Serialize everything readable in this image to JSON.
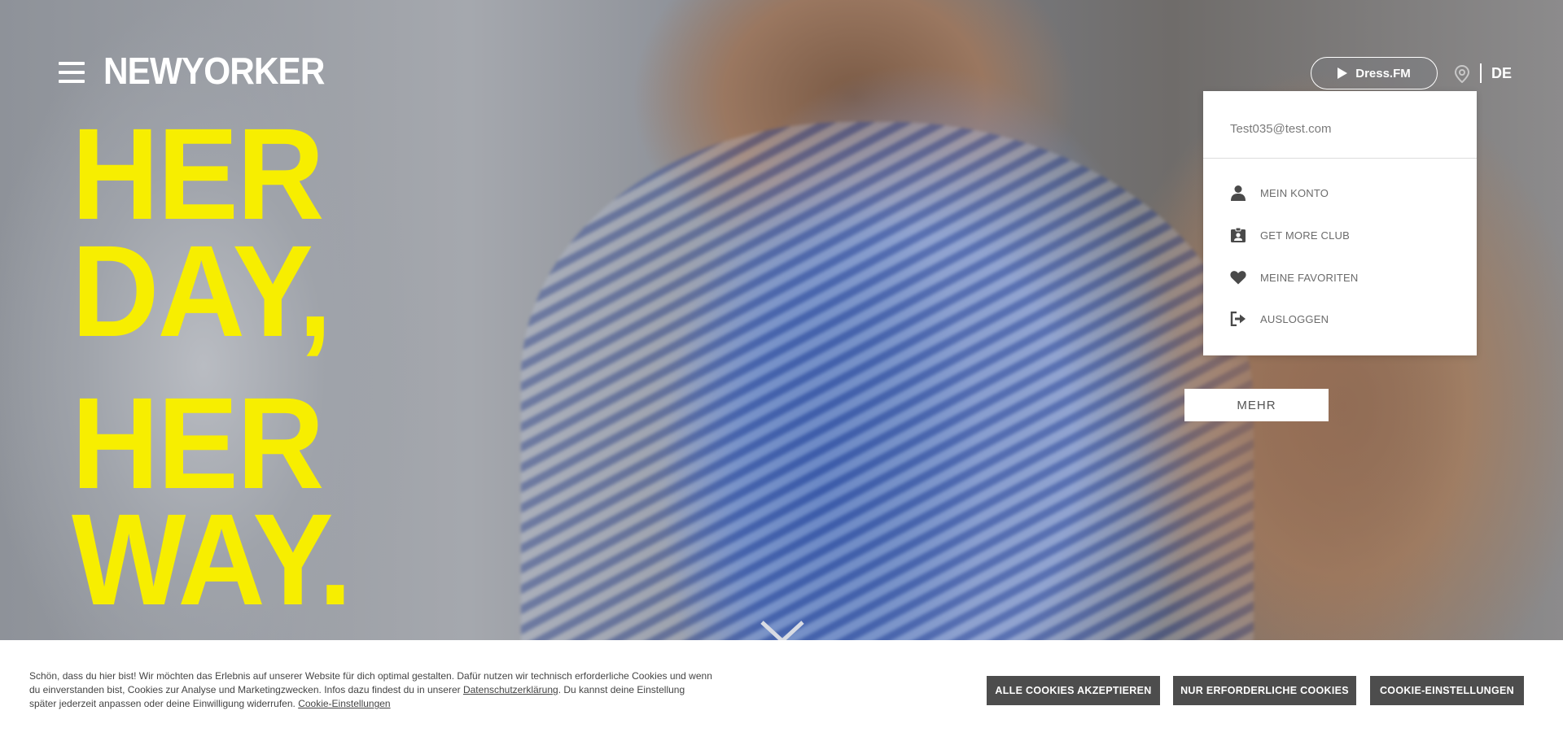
{
  "header": {
    "logo_text": "NEWYORKER",
    "dressfm_label": "Dress.FM",
    "language": "DE"
  },
  "account_menu": {
    "email": "Test035@test.com",
    "items": [
      {
        "label": "MEIN KONTO",
        "icon": "user-icon"
      },
      {
        "label": "GET MORE CLUB",
        "icon": "member-card-icon"
      },
      {
        "label": "MEINE FAVORITEN",
        "icon": "heart-icon"
      },
      {
        "label": "AUSLOGGEN",
        "icon": "logout-icon"
      }
    ]
  },
  "hero": {
    "headline_lines": [
      "HER",
      "DAY,",
      "HER",
      "WAY."
    ],
    "mehr_label": "MEHR",
    "headline_color": "#f7ee00"
  },
  "cookie_banner": {
    "text_part1": "Schön, dass du hier bist! Wir möchten das Erlebnis auf unserer Website für dich optimal gestalten. Dafür nutzen wir technisch erforderliche Cookies und wenn du einverstanden bist, Cookies zur Analyse und Marketingzwecken. Infos dazu findest du in unserer ",
    "privacy_link": "Datenschutzerklärung",
    "text_part2": ". Du kannst deine Einstellung später jederzeit anpassen oder deine Einwilligung widerrufen. ",
    "settings_link": "Cookie-Einstellungen",
    "buttons": {
      "accept_all": "ALLE COOKIES AKZEPTIEREN",
      "necessary_only": "NUR ERFORDERLICHE COOKIES",
      "settings": "COOKIE-EINSTELLUNGEN"
    },
    "button_color": "#4d4d4d"
  }
}
